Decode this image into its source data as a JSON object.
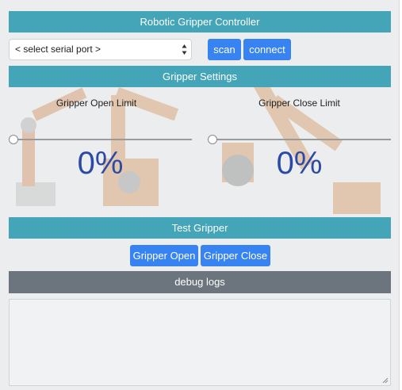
{
  "header": {
    "title": "Robotic Gripper Controller"
  },
  "serial": {
    "port_select_value": "< select serial port >",
    "scan_label": "scan",
    "connect_label": "connect"
  },
  "settings": {
    "title": "Gripper Settings",
    "open_limit": {
      "label": "Gripper Open Limit",
      "value": 0,
      "display": "0%"
    },
    "close_limit": {
      "label": "Gripper Close Limit",
      "value": 0,
      "display": "0%"
    }
  },
  "test": {
    "title": "Test Gripper",
    "open_label": "Gripper Open",
    "close_label": "Gripper Close"
  },
  "debug": {
    "title": "debug logs",
    "log_text": ""
  },
  "colors": {
    "section_bar": "#44a5b9",
    "debug_bar": "#6c757d",
    "button": "#3883f2",
    "percent_text": "#2c4aa5"
  }
}
